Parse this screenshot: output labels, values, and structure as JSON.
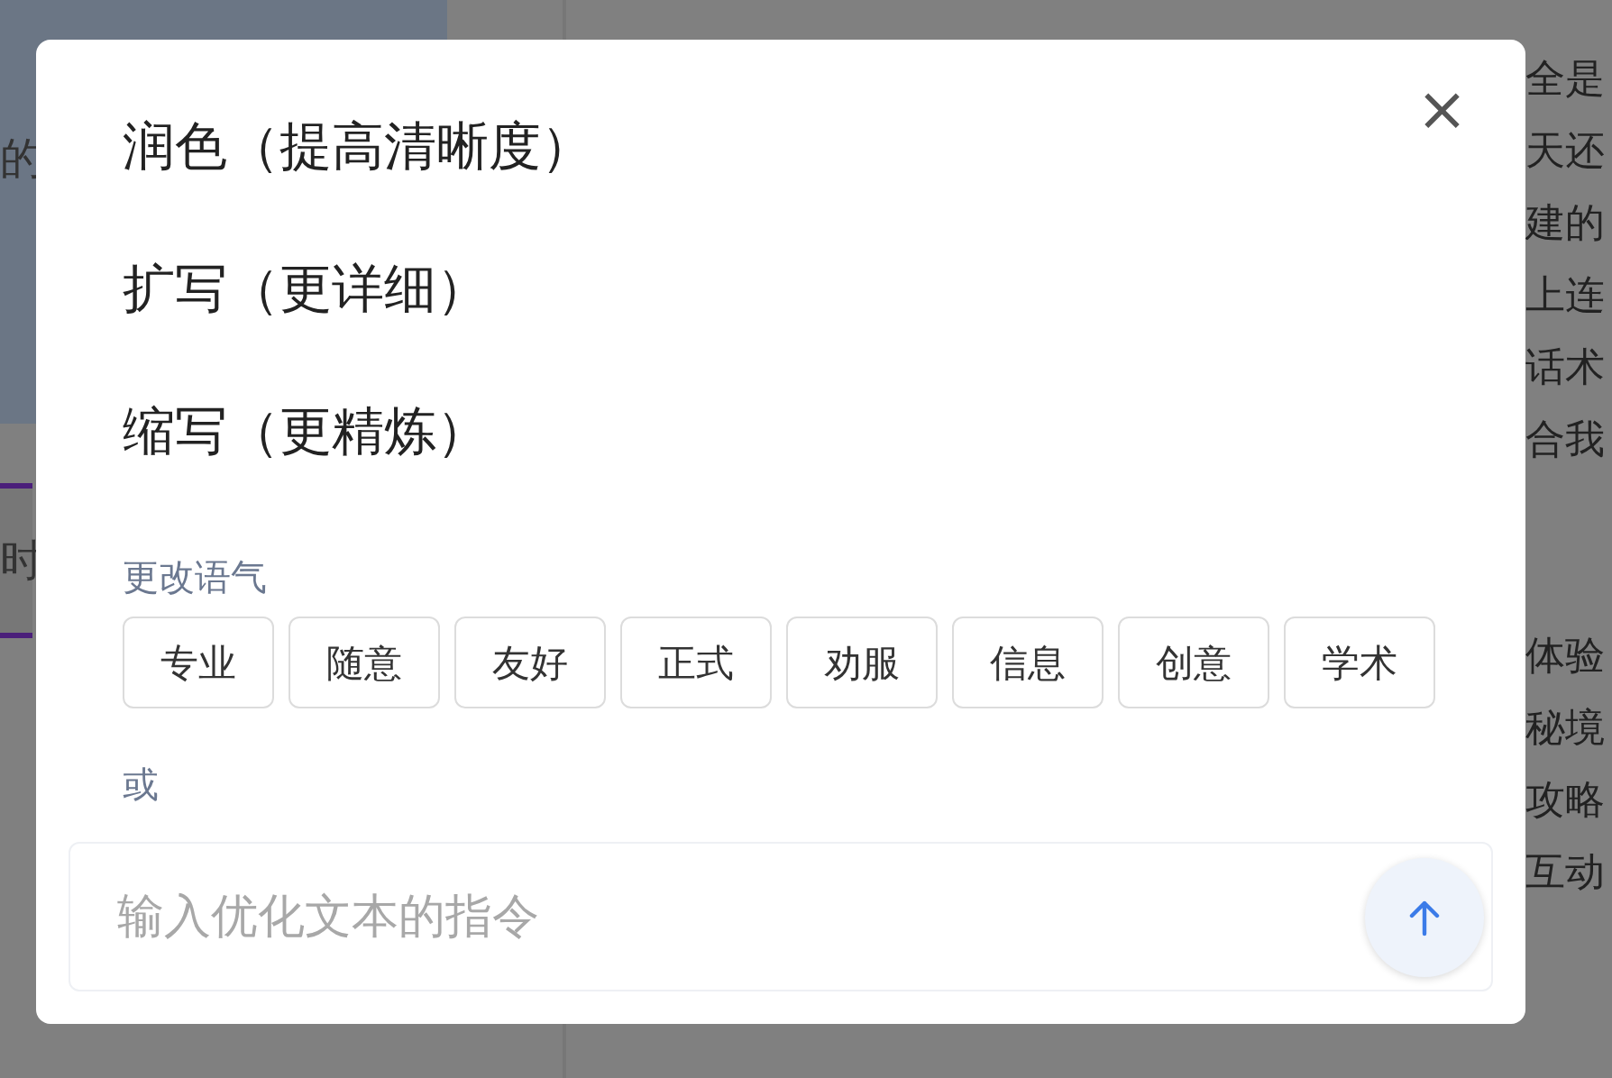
{
  "background": {
    "left_fragments": [
      "的",
      "时"
    ],
    "right_fragments": [
      "全是",
      "天还",
      "建的",
      "上连",
      "话术",
      "合我"
    ],
    "right_fragments_lower": [
      "体验",
      "秘境",
      "攻略",
      "互动"
    ]
  },
  "dialog": {
    "close_label": "×",
    "actions": [
      "润色（提高清晰度）",
      "扩写（更详细）",
      "缩写（更精炼）"
    ],
    "tone_label": "更改语气",
    "tones": [
      "专业",
      "随意",
      "友好",
      "正式",
      "劝服",
      "信息",
      "创意",
      "学术"
    ],
    "or_label": "或",
    "input": {
      "placeholder": "输入优化文本的指令"
    }
  }
}
